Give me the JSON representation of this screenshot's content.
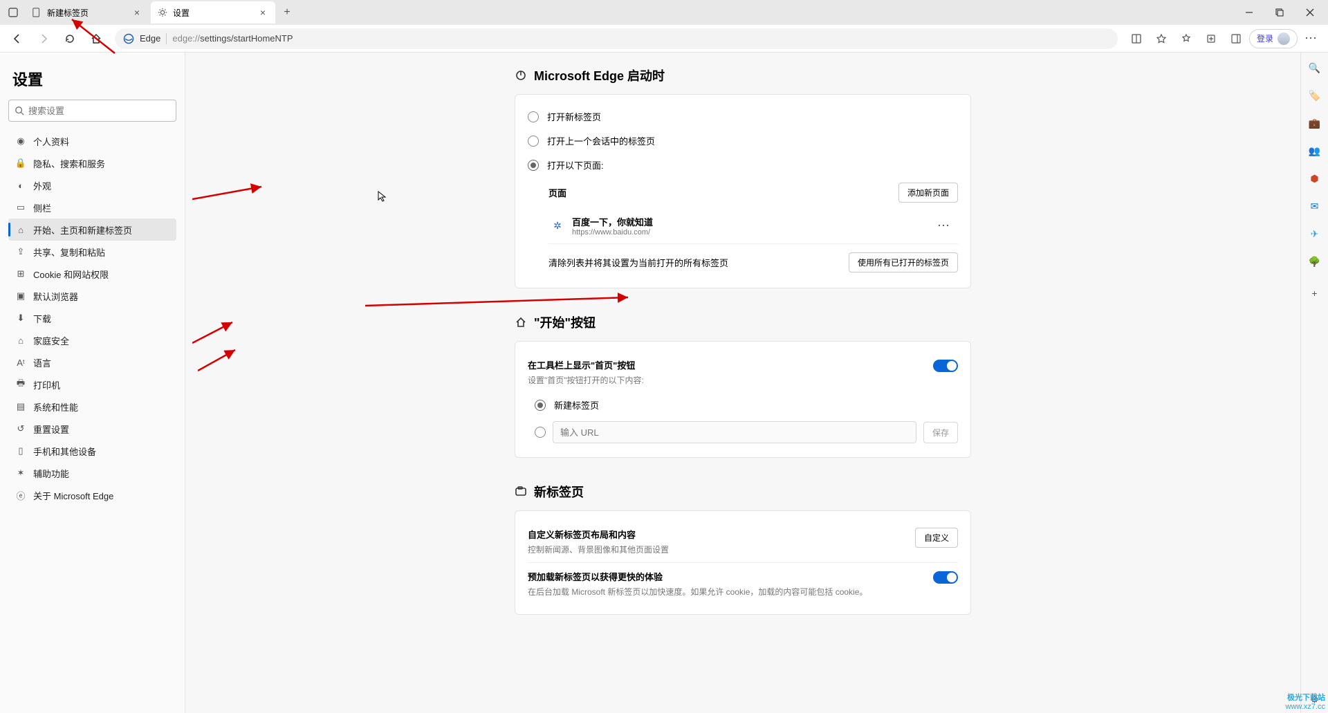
{
  "tabs": [
    {
      "title": "新建标签页",
      "active": false
    },
    {
      "title": "设置",
      "active": true
    }
  ],
  "addressbar": {
    "brand": "Edge",
    "url_prefix": "edge://",
    "url_rest": "settings/startHomeNTP",
    "login_label": "登录"
  },
  "sidebar": {
    "title": "设置",
    "search_placeholder": "搜索设置",
    "items": [
      {
        "label": "个人资料",
        "icon": "person-icon"
      },
      {
        "label": "隐私、搜索和服务",
        "icon": "lock-icon"
      },
      {
        "label": "外观",
        "icon": "appearance-icon"
      },
      {
        "label": "侧栏",
        "icon": "sidebar-icon"
      },
      {
        "label": "开始、主页和新建标签页",
        "icon": "home-icon",
        "active": true
      },
      {
        "label": "共享、复制和粘贴",
        "icon": "share-icon"
      },
      {
        "label": "Cookie 和网站权限",
        "icon": "cookie-icon"
      },
      {
        "label": "默认浏览器",
        "icon": "browser-icon"
      },
      {
        "label": "下载",
        "icon": "download-icon"
      },
      {
        "label": "家庭安全",
        "icon": "family-icon"
      },
      {
        "label": "语言",
        "icon": "language-icon"
      },
      {
        "label": "打印机",
        "icon": "printer-icon"
      },
      {
        "label": "系统和性能",
        "icon": "system-icon"
      },
      {
        "label": "重置设置",
        "icon": "reset-icon"
      },
      {
        "label": "手机和其他设备",
        "icon": "phone-icon"
      },
      {
        "label": "辅助功能",
        "icon": "accessibility-icon"
      },
      {
        "label": "关于 Microsoft Edge",
        "icon": "edge-icon"
      }
    ]
  },
  "startup": {
    "title": "Microsoft Edge 启动时",
    "option_newtab": "打开新标签页",
    "option_prev": "打开上一个会话中的标签页",
    "option_pages": "打开以下页面:",
    "pages_header": "页面",
    "add_page_btn": "添加新页面",
    "page": {
      "title": "百度一下，你就知道",
      "url": "https://www.baidu.com/"
    },
    "clear_text": "清除列表并将其设置为当前打开的所有标签页",
    "use_open_btn": "使用所有已打开的标签页"
  },
  "homebtn": {
    "title": "\"开始\"按钮",
    "show_label": "在工具栏上显示\"首页\"按钮",
    "show_desc": "设置\"首页\"按钮打开的以下内容:",
    "option_newtab": "新建标签页",
    "url_placeholder": "输入 URL",
    "save_btn": "保存"
  },
  "newtab": {
    "title": "新标签页",
    "customize_label": "自定义新标签页布局和内容",
    "customize_desc": "控制新闻源、背景图像和其他页面设置",
    "customize_btn": "自定义",
    "preload_label": "预加载新标签页以获得更快的体验",
    "preload_desc": "在后台加载 Microsoft 新标签页以加快速度。如果允许 cookie，加载的内容可能包括 cookie。"
  },
  "watermark": {
    "l1": "极光下载站",
    "l2": "www.xz7.cc"
  }
}
